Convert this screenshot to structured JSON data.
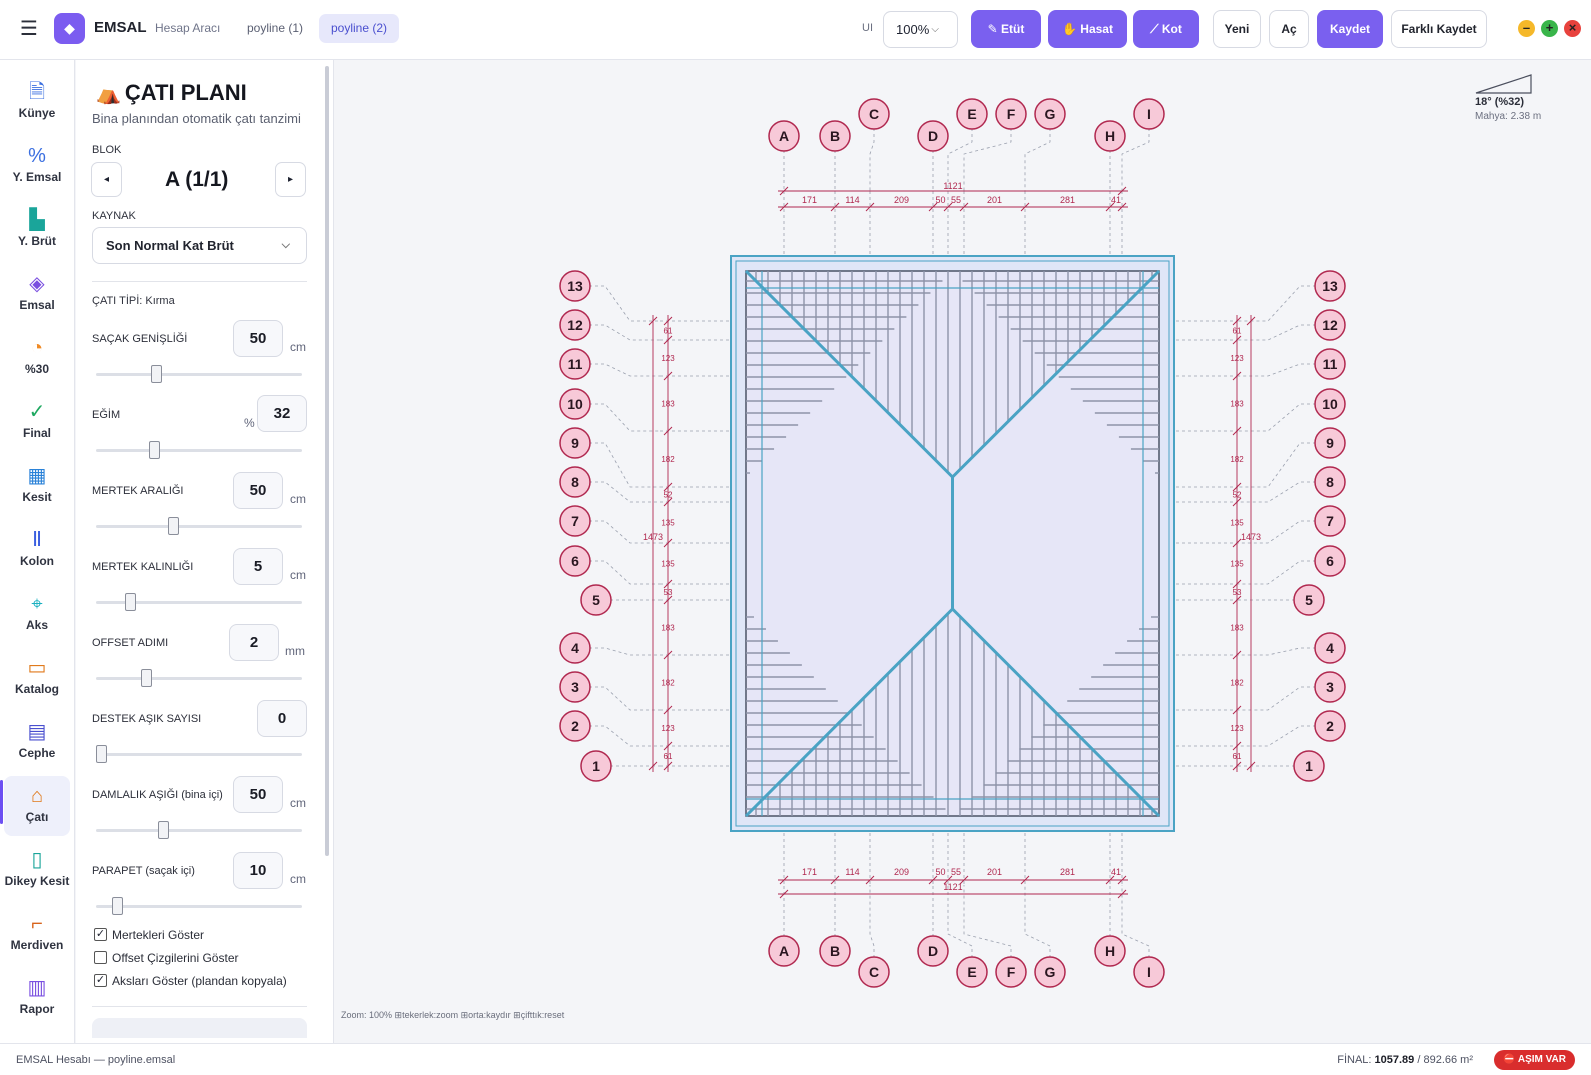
{
  "header": {
    "app_name": "EMSAL",
    "app_subtitle": "Hesap Aracı",
    "tabs": [
      {
        "label": "poyline (1)"
      },
      {
        "label": "poyline (2)"
      }
    ],
    "ui_label": "UI",
    "zoom_value": "100%",
    "buttons": {
      "etut": "Etüt",
      "hasat": "Hasat",
      "kot": "Kot",
      "yeni": "Yeni",
      "ac": "Aç",
      "kaydet": "Kaydet",
      "farkli_kaydet": "Farklı Kaydet"
    }
  },
  "nav": {
    "items": [
      {
        "label": "Künye",
        "icon": "document-icon"
      },
      {
        "label": "Y. Emsal",
        "icon": "percent-icon"
      },
      {
        "label": "Y. Brüt",
        "icon": "bar-chart-icon"
      },
      {
        "label": "Emsal",
        "icon": "layers-icon"
      },
      {
        "label": "%30",
        "icon": "pie-icon"
      },
      {
        "label": "Final",
        "icon": "check-circle-icon"
      },
      {
        "label": "Kesit",
        "icon": "building-icon"
      },
      {
        "label": "Kolon",
        "icon": "column-icon"
      },
      {
        "label": "Aks",
        "icon": "crosshair-icon"
      },
      {
        "label": "Katalog",
        "icon": "book-icon"
      },
      {
        "label": "Cephe",
        "icon": "grid-icon"
      },
      {
        "label": "Çatı",
        "icon": "home-icon"
      },
      {
        "label": "Dikey Kesit",
        "icon": "ruler-icon"
      },
      {
        "label": "Merdiven",
        "icon": "stairs-icon"
      },
      {
        "label": "Rapor",
        "icon": "report-icon"
      }
    ],
    "active": "Çatı"
  },
  "panel": {
    "title": "ÇATI PLANI",
    "subtitle": "Bina planından otomatik çatı tanzimi",
    "block_label": "BLOK",
    "block_value": "A  (1/1)",
    "source_label": "KAYNAK",
    "source_value": "Son Normal Kat Brüt",
    "roof_type": "ÇATI TİPİ: Kırma",
    "params": [
      {
        "label": "SAÇAK GENİŞLİĞİ",
        "value": "50",
        "unit": "cm",
        "level": 0.28
      },
      {
        "label": "EĞİM",
        "value": "32",
        "unit": "%",
        "level": 0.27
      },
      {
        "label": "MERTEK ARALIĞI",
        "value": "50",
        "unit": "cm",
        "level": 0.37
      },
      {
        "label": "MERTEK KALINLIĞI",
        "value": "5",
        "unit": "cm",
        "level": 0.15
      },
      {
        "label": "OFFSET ADIMI",
        "value": "2",
        "unit": "mm",
        "level": 0.23
      },
      {
        "label": "DESTEK AŞIK SAYISI",
        "value": "0",
        "unit": "",
        "level": 0.0
      },
      {
        "label": "DAMLALIK AŞIĞI (bina içi)",
        "value": "50",
        "unit": "cm",
        "level": 0.32
      },
      {
        "label": "PARAPET (saçak içi)",
        "value": "10",
        "unit": "cm",
        "level": 0.08
      }
    ],
    "checks": [
      {
        "label": "Mertekleri Göster",
        "checked": true
      },
      {
        "label": "Offset Çizgilerini Göster",
        "checked": false
      },
      {
        "label": "Aksları Göster (plandan kopyala)",
        "checked": true
      }
    ]
  },
  "canvas": {
    "pitch_title": "18° (%32)",
    "pitch_sub": "Mahya: 2.38 m",
    "hint": "Zoom: 100%  ⊞tekerlek:zoom  ⊞orta:kaydır  ⊞çifttık:reset",
    "col_axes": [
      "A",
      "B",
      "C",
      "D",
      "E",
      "F",
      "G",
      "H",
      "I"
    ],
    "row_axes": [
      "13",
      "12",
      "11",
      "10",
      "9",
      "8",
      "7",
      "6",
      "5",
      "4",
      "3",
      "2",
      "1"
    ],
    "col_dims": [
      "171",
      "114",
      "209",
      "50",
      "55",
      "201",
      "281",
      "41"
    ],
    "col_total": "1121",
    "row_dims": [
      "61",
      "123",
      "183",
      "182",
      "52",
      "135",
      "135",
      "53",
      "183",
      "182",
      "123",
      "61"
    ],
    "row_total": "1473"
  },
  "status": {
    "left": "EMSAL Hesabı — poyline.emsal",
    "final_label": "FİNAL:",
    "final_value": "1057.89",
    "final_limit": "/ 892.66 m²",
    "badge": "⛔ AŞIM VAR"
  },
  "colors": {
    "accent": "#7a60ef",
    "axis": "#b0284f",
    "roof": "#4aa3c4",
    "danger": "#d92d2d"
  }
}
